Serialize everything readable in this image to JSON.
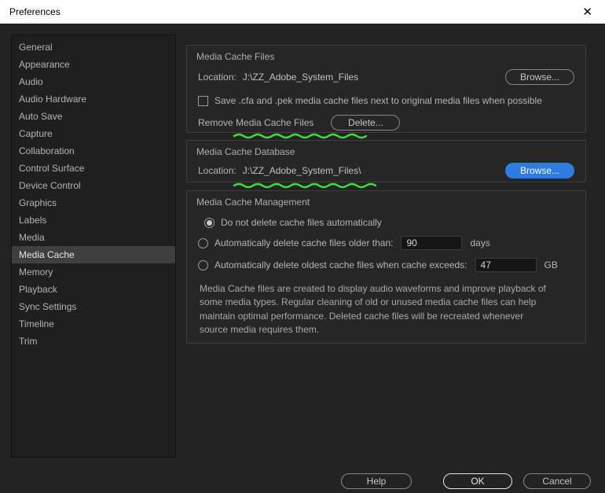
{
  "window": {
    "title": "Preferences",
    "close_icon": "✕"
  },
  "colors": {
    "accent_blue": "#2d7de1",
    "annotation_green": "#3ddc3d"
  },
  "sidebar": {
    "selected": "Media Cache",
    "items": [
      "General",
      "Appearance",
      "Audio",
      "Audio Hardware",
      "Auto Save",
      "Capture",
      "Collaboration",
      "Control Surface",
      "Device Control",
      "Graphics",
      "Labels",
      "Media",
      "Media Cache",
      "Memory",
      "Playback",
      "Sync Settings",
      "Timeline",
      "Trim"
    ]
  },
  "cache_files": {
    "title": "Media Cache Files",
    "location_label": "Location:",
    "location_value": "J:\\ZZ_Adobe_System_Files",
    "browse": "Browse...",
    "save_next_checkbox": "Save .cfa and .pek media cache files next to original media files when possible",
    "remove_label": "Remove Media Cache Files",
    "delete": "Delete..."
  },
  "cache_database": {
    "title": "Media Cache Database",
    "location_label": "Location:",
    "location_value": "J:\\ZZ_Adobe_System_Files\\",
    "browse": "Browse..."
  },
  "cache_management": {
    "title": "Media Cache Management",
    "option_no_delete": "Do not delete cache files automatically",
    "option_older_than": "Automatically delete cache files older than:",
    "older_than_value": "90",
    "older_than_unit": "days",
    "option_exceeds": "Automatically delete oldest cache files when cache exceeds:",
    "exceeds_value": "47",
    "exceeds_unit": "GB",
    "description": "Media Cache files are created to display audio waveforms and improve playback of some media types.  Regular cleaning of old or unused media cache files can help maintain optimal performance. Deleted cache files will be recreated whenever source media requires them."
  },
  "footer": {
    "help": "Help",
    "ok": "OK",
    "cancel": "Cancel"
  }
}
